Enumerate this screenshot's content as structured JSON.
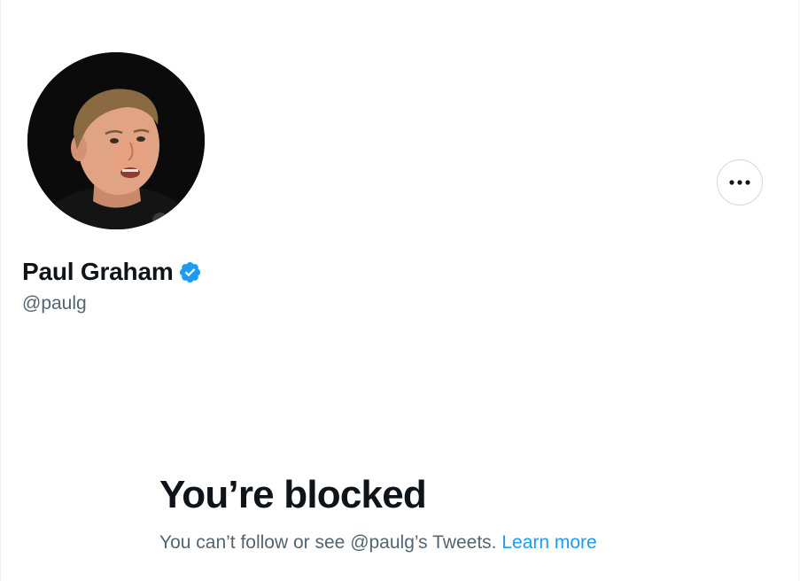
{
  "profile": {
    "display_name": "Paul Graham",
    "handle": "@paulg",
    "verified": true,
    "avatar_icon": "profile-photo",
    "more_icon": "more-horizontal-icon",
    "verified_icon": "verified-badge-icon"
  },
  "blocked": {
    "title": "You’re blocked",
    "message": "You can’t follow or see @paulg’s Tweets.",
    "learn_more": "Learn more"
  },
  "colors": {
    "text_primary": "#0f1419",
    "text_secondary": "#536471",
    "accent_blue": "#1d9bf0",
    "border": "#cfd9de"
  }
}
